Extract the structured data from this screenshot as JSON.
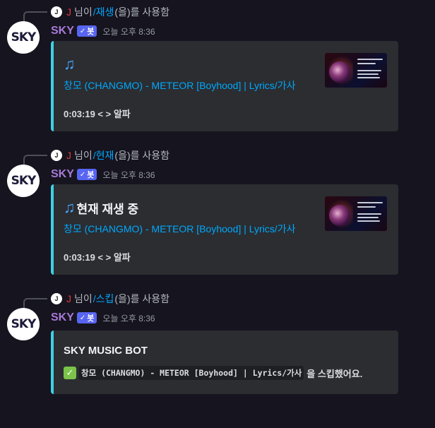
{
  "messages": [
    {
      "reply": {
        "avatar_letter": "J",
        "username": "J",
        "prefix": "님이",
        "command": "/재생",
        "suffix": "(을)를 사용함"
      },
      "avatar_text": "SKY",
      "author": "SKY",
      "bot_tag": "봇",
      "timestamp": "오늘 오후 8:36",
      "embed": {
        "title": "",
        "song": "창모 (CHANGMO) - METEOR [Boyhood] | Lyrics/가사",
        "time_row": "0:03:19 < > 알파"
      }
    },
    {
      "reply": {
        "avatar_letter": "J",
        "username": "J",
        "prefix": "님이",
        "command": "/현재",
        "suffix": "(을)를 사용함"
      },
      "avatar_text": "SKY",
      "author": "SKY",
      "bot_tag": "봇",
      "timestamp": "오늘 오후 8:36",
      "embed": {
        "title": "현재 재생 중",
        "song": "창모 (CHANGMO) - METEOR [Boyhood] | Lyrics/가사",
        "time_row": "0:03:19 < > 알파"
      }
    },
    {
      "reply": {
        "avatar_letter": "J",
        "username": "J",
        "prefix": "님이",
        "command": "/스킵",
        "suffix": "(을)를 사용함"
      },
      "avatar_text": "SKY",
      "author": "SKY",
      "bot_tag": "봇",
      "timestamp": "오늘 오후 8:36",
      "embed": {
        "title": "SKY MUSIC BOT",
        "skipped_song": "창모 (CHANGMO) - METEOR [Boyhood] | Lyrics/가사",
        "skip_suffix": "을 스킵했어요."
      }
    }
  ],
  "icons": {
    "music_note": "music-note-icon",
    "check": "check-icon",
    "green_check": "green-check-icon"
  },
  "colors": {
    "embed_border": "#3fd0e0",
    "link": "#00a8fc",
    "author": "#a67ad8",
    "bot_tag": "#5865f2",
    "reply_user": "#e03a3a"
  }
}
